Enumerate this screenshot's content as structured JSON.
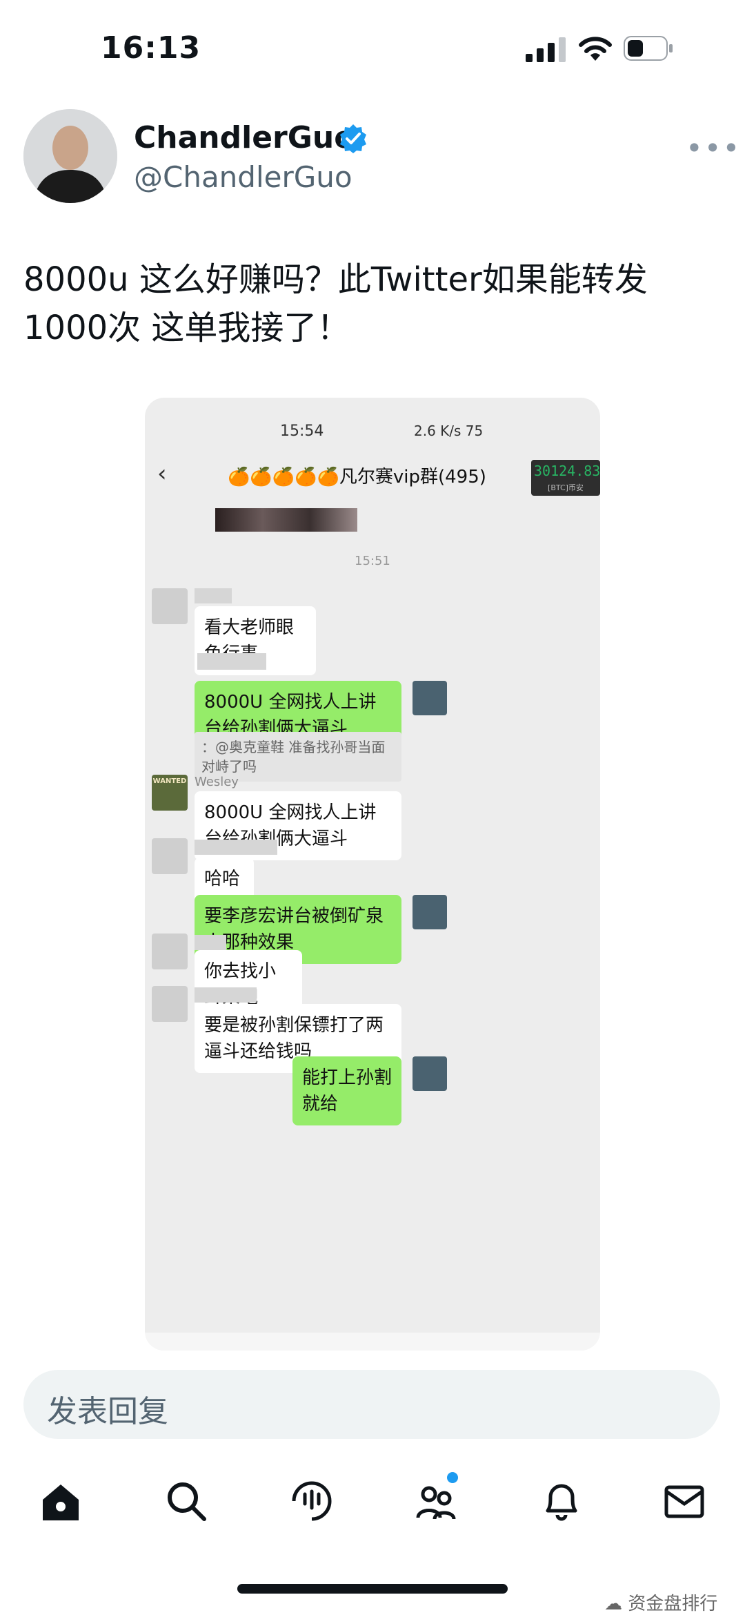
{
  "status_bar": {
    "time": "16:13"
  },
  "tweet": {
    "display_name": "ChandlerGuo",
    "handle": "@ChandlerGuo",
    "text_line1": "8000u 这么好赚吗？此Twitter如果能转发",
    "text_line2": "1000次 这单我接了！"
  },
  "screenshot": {
    "status_time": "15:54",
    "status_icons": "2.6 K/s  75",
    "group_title": "🍊🍊🍊🍊🍊凡尔赛vip群(495)",
    "btc_value": "30124.83",
    "btc_label": "[BTC]币安",
    "timestamp": "15:51",
    "messages": [
      {
        "text": "看大老师眼色行事，"
      },
      {
        "text": "8000U 全网找人上讲台给孙割俩大逼斗"
      },
      {
        "quote": "：@奥克童鞋 准备找孙哥当面对峙了吗"
      },
      {
        "sender": "Wesley",
        "text": "8000U 全网找人上讲台给孙割俩大逼斗"
      },
      {
        "text": "哈哈哈"
      },
      {
        "text": "要李彦宏讲台被倒矿泉水那种效果"
      },
      {
        "text": "你去找小耳朵吧"
      },
      {
        "text": "要是被孙割保镖打了两逼斗还给钱吗"
      },
      {
        "text": "能打上孙割就给"
      }
    ],
    "wanted_label": "WANTED"
  },
  "reply_placeholder": "发表回复",
  "watermark": "资金盘排行",
  "icons": [
    "home-icon",
    "search-icon",
    "spaces-icon",
    "communities-icon",
    "bell-icon",
    "mail-icon"
  ],
  "colors": {
    "verified": "#1d9bf0",
    "bubble_green": "#95ec69",
    "notify_dot": "#1d9bf0"
  }
}
